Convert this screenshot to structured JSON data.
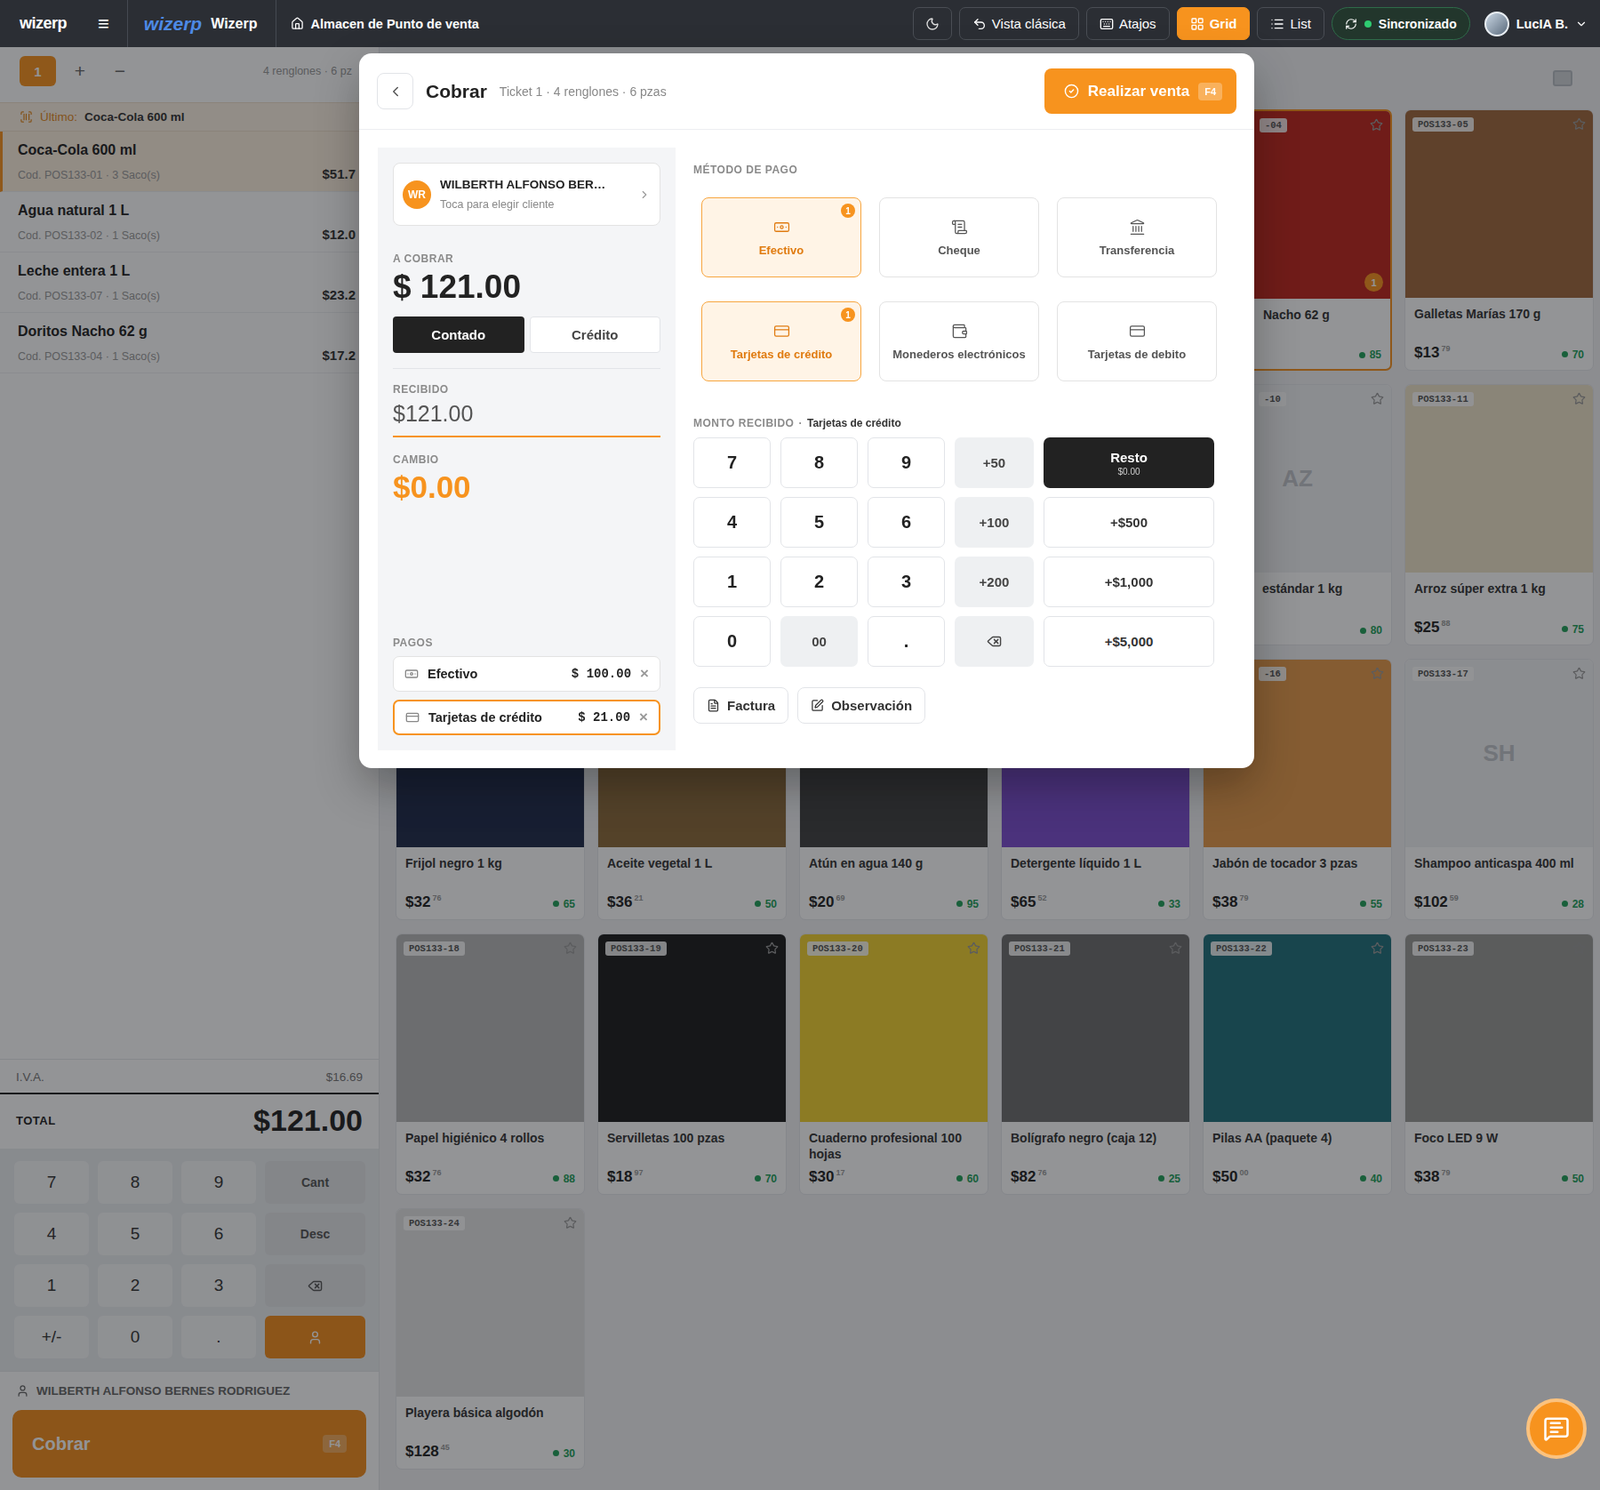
{
  "topbar": {
    "logo": "wizerp",
    "menu": "≡",
    "brand_logo": "wizerp",
    "brand": "Wizerp",
    "store": "Almacen de Punto de venta",
    "actions": [
      {
        "label": "Vista clásica",
        "kind": "classic",
        "selected": false
      },
      {
        "label": "Atajos",
        "kind": "shortcuts",
        "selected": false
      },
      {
        "label": "Grid",
        "kind": "grid",
        "selected": true
      },
      {
        "label": "List",
        "kind": "list",
        "selected": false
      }
    ],
    "sync": {
      "label": "Sincronizado",
      "on": true
    },
    "user": {
      "name": "LucIA B."
    }
  },
  "ticket_bar": {
    "tickets": [
      {
        "label": "1",
        "selected": true
      }
    ],
    "add": "+",
    "remove": "−",
    "summary": "4 renglones · 6 pz"
  },
  "last_scanned": {
    "label": "Último:",
    "name": "Coca-Cola 600 ml"
  },
  "cart": [
    {
      "name": "Coca-Cola 600 ml",
      "meta": "Cod. POS133-01 · 3 Saco(s)",
      "price": "$51.7",
      "selected": true
    },
    {
      "name": "Agua natural 1 L",
      "meta": "Cod. POS133-02 · 1 Saco(s)",
      "price": "$12.0",
      "selected": false
    },
    {
      "name": "Leche entera 1 L",
      "meta": "Cod. POS133-07 · 1 Saco(s)",
      "price": "$23.2",
      "selected": false
    },
    {
      "name": "Doritos Nacho 62 g",
      "meta": "Cod. POS133-04 · 1 Saco(s)",
      "price": "$17.2",
      "selected": false
    }
  ],
  "totals": {
    "iva_label": "I.V.A.",
    "iva": "$16.69",
    "total_label": "TOTAL",
    "total": "$121.00"
  },
  "keypad": [
    {
      "label": "7",
      "kind": "digit"
    },
    {
      "label": "8",
      "kind": "digit"
    },
    {
      "label": "9",
      "kind": "digit"
    },
    {
      "label": "Cant",
      "kind": "fn"
    },
    {
      "label": "4",
      "kind": "digit"
    },
    {
      "label": "5",
      "kind": "digit"
    },
    {
      "label": "6",
      "kind": "digit"
    },
    {
      "label": "Desc",
      "kind": "fn"
    },
    {
      "label": "1",
      "kind": "digit"
    },
    {
      "label": "2",
      "kind": "digit"
    },
    {
      "label": "3",
      "kind": "digit"
    },
    {
      "kind": "backspace"
    },
    {
      "label": "+/-",
      "kind": "digit"
    },
    {
      "label": "0",
      "kind": "digit"
    },
    {
      "label": ".",
      "kind": "digit"
    },
    {
      "kind": "customer"
    }
  ],
  "customer": "WILBERTH ALFONSO BERNES RODRIGUEZ",
  "checkout": {
    "label": "Cobrar",
    "shortcut": "F4"
  },
  "products": [
    {
      "kind": "hidden"
    },
    {
      "kind": "hidden"
    },
    {
      "kind": "hidden"
    },
    {
      "kind": "hidden"
    },
    {
      "kind": "photo",
      "covered": "side",
      "code": "-04",
      "name": "Nacho 62 g",
      "stock": "85",
      "badge": "1",
      "color": "#c0261c",
      "selected": true
    },
    {
      "kind": "photo",
      "covered": "none",
      "code": "POS133-05",
      "name": "Galletas Marías 170 g",
      "price": "$13",
      "cents": "79",
      "stock": "70",
      "color": "#a0683c",
      "selected": false
    },
    {
      "kind": "hidden"
    },
    {
      "kind": "hidden"
    },
    {
      "kind": "hidden"
    },
    {
      "kind": "hidden"
    },
    {
      "kind": "placeholder",
      "covered": "side",
      "code": "-10",
      "initials": "AZ",
      "name": "estándar 1 kg",
      "stock": "80",
      "selected": false
    },
    {
      "kind": "photo",
      "covered": "none",
      "code": "POS133-11",
      "name": "Arroz súper extra 1 kg",
      "price": "$25",
      "cents": "88",
      "stock": "75",
      "color": "#efe3c8",
      "selected": false
    },
    {
      "kind": "photo",
      "covered": "none",
      "name": "Frijol negro 1 kg",
      "price": "$32",
      "cents": "76",
      "stock": "65",
      "color": "#1f2a4a",
      "selected": false
    },
    {
      "kind": "photo",
      "covered": "none",
      "name": "Aceite vegetal 1 L",
      "price": "$36",
      "cents": "21",
      "stock": "50",
      "color": "#8c6a3a",
      "selected": false
    },
    {
      "kind": "photo",
      "covered": "none",
      "name": "Atún en agua 140 g",
      "price": "$20",
      "cents": "69",
      "stock": "95",
      "color": "#404040",
      "selected": false
    },
    {
      "kind": "photo",
      "covered": "none",
      "name": "Detergente líquido 1 L",
      "price": "$65",
      "cents": "52",
      "stock": "33",
      "color": "#7c4dd0",
      "selected": false
    },
    {
      "kind": "photo",
      "covered": "corner",
      "code": "-16",
      "name": "Jabón de tocador 3 pzas",
      "price": "$38",
      "cents": "79",
      "stock": "55",
      "color": "#e69a4a",
      "selected": false
    },
    {
      "kind": "placeholder",
      "covered": "none",
      "code": "POS133-17",
      "initials": "SH",
      "name": "Shampoo anticaspa 400 ml",
      "price": "$102",
      "cents": "59",
      "stock": "28",
      "selected": false
    },
    {
      "kind": "photo",
      "covered": "none",
      "code": "POS133-18",
      "name": "Papel higiénico 4 rollos",
      "price": "$32",
      "cents": "76",
      "stock": "88",
      "color": "#b8b8b8",
      "selected": false
    },
    {
      "kind": "photo",
      "covered": "none",
      "code": "POS133-19",
      "name": "Servilletas 100 pzas",
      "price": "$18",
      "cents": "97",
      "stock": "70",
      "color": "#1c1c1c",
      "selected": false
    },
    {
      "kind": "photo",
      "covered": "none",
      "code": "POS133-20",
      "name": "Cuaderno profesional 100 hojas",
      "price": "$30",
      "cents": "17",
      "stock": "60",
      "color": "#f2d230",
      "selected": false
    },
    {
      "kind": "photo",
      "covered": "none",
      "code": "POS133-21",
      "name": "Bolígrafo negro (caja 12)",
      "price": "$82",
      "cents": "76",
      "stock": "25",
      "color": "#6e6e6e",
      "selected": false
    },
    {
      "kind": "photo",
      "covered": "none",
      "code": "POS133-22",
      "name": "Pilas AA (paquete 4)",
      "price": "$50",
      "cents": "00",
      "stock": "40",
      "color": "#1f6f7a",
      "selected": false
    },
    {
      "kind": "photo",
      "covered": "none",
      "code": "POS133-23",
      "name": "Foco LED 9 W",
      "price": "$38",
      "cents": "79",
      "stock": "50",
      "color": "#9a9a96",
      "selected": false
    },
    {
      "kind": "photo",
      "covered": "none",
      "code": "POS133-24",
      "name": "Playera básica algodón",
      "price": "$128",
      "cents": "45",
      "stock": "30",
      "color": "#e4e4e4",
      "selected": false
    }
  ],
  "modal": {
    "title": "Cobrar",
    "subtitle": "Ticket 1 · 4 renglones · 6 pzas",
    "submit": {
      "label": "Realizar venta",
      "shortcut": "F4"
    },
    "client": {
      "initials": "WR",
      "name": "WILBERTH ALFONSO BER…",
      "hint": "Toca para elegir cliente"
    },
    "due_label": "A COBRAR",
    "due": "$ 121.00",
    "terms": [
      {
        "label": "Contado",
        "selected": true
      },
      {
        "label": "Crédito",
        "selected": false
      }
    ],
    "received_label": "RECIBIDO",
    "received": "$121.00",
    "change_label": "CAMBIO",
    "change": "$0.00",
    "payments_label": "PAGOS",
    "payments": [
      {
        "method": "Efectivo",
        "kind": "cash",
        "amount": "$ 100.00",
        "remove": "×",
        "selected": false
      },
      {
        "method": "Tarjetas de crédito",
        "kind": "card",
        "amount": "$ 21.00",
        "remove": "×",
        "selected": true
      }
    ],
    "methods_label": "MÉTODO DE PAGO",
    "methods": [
      {
        "label": "Efectivo",
        "kind": "cash",
        "selected": true,
        "badge": "1"
      },
      {
        "label": "Cheque",
        "kind": "cheque",
        "selected": false
      },
      {
        "label": "Transferencia",
        "kind": "transfer",
        "selected": false
      },
      {
        "label": "Tarjetas de crédito",
        "kind": "credit",
        "selected": true,
        "badge": "1"
      },
      {
        "label": "Monederos electrónicos",
        "kind": "wallet",
        "selected": false
      },
      {
        "label": "Tarjetas de debito",
        "kind": "debit",
        "selected": false
      }
    ],
    "amount_label": "MONTO RECIBIDO",
    "amount_sep": "·",
    "amount_method": "Tarjetas de crédito",
    "pad": [
      {
        "label": "7",
        "kind": "digit"
      },
      {
        "label": "8",
        "kind": "digit"
      },
      {
        "label": "9",
        "kind": "digit"
      },
      {
        "label": "+50",
        "kind": "quick"
      },
      {
        "label": "4",
        "kind": "digit"
      },
      {
        "label": "5",
        "kind": "digit"
      },
      {
        "label": "6",
        "kind": "digit"
      },
      {
        "label": "+100",
        "kind": "quick"
      },
      {
        "label": "1",
        "kind": "digit"
      },
      {
        "label": "2",
        "kind": "digit"
      },
      {
        "label": "3",
        "kind": "digit"
      },
      {
        "label": "+200",
        "kind": "quick"
      },
      {
        "label": "0",
        "kind": "digit"
      },
      {
        "label": "00",
        "kind": "quick"
      },
      {
        "label": ".",
        "kind": "digit"
      },
      {
        "kind": "backspace"
      }
    ],
    "amounts": [
      {
        "label": "Resto",
        "sub": "$0.00",
        "kind": "primary"
      },
      {
        "label": "+$500",
        "kind": "plain"
      },
      {
        "label": "+$1,000",
        "kind": "plain"
      },
      {
        "label": "+$5,000",
        "kind": "plain"
      }
    ],
    "footer_buttons": [
      {
        "label": "Factura",
        "kind": "invoice"
      },
      {
        "label": "Observación",
        "kind": "note"
      }
    ]
  }
}
